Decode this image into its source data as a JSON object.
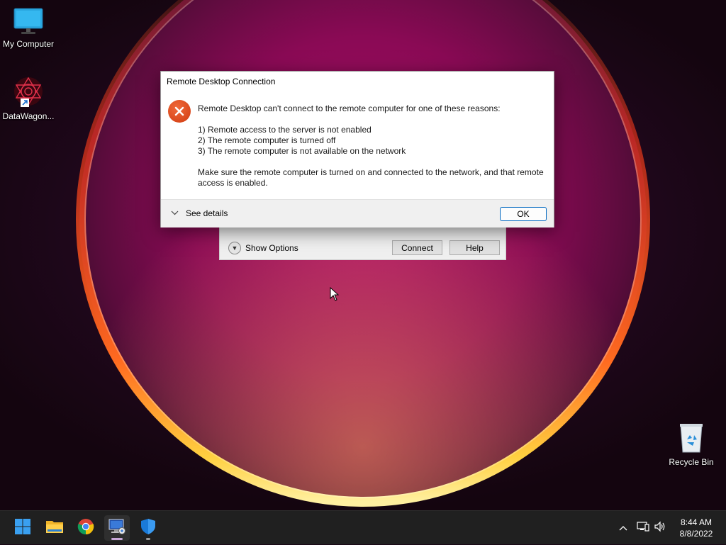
{
  "desktop": {
    "icons": [
      {
        "label": "My Computer",
        "icon": "monitor-icon"
      },
      {
        "label": "DataWagon...",
        "icon": "datawagon-shortcut-icon"
      },
      {
        "label": "Recycle Bin",
        "icon": "recycle-bin-icon"
      }
    ]
  },
  "rdc_window": {
    "show_options_label": "Show Options",
    "connect_label": "Connect",
    "help_label": "Help"
  },
  "dialog": {
    "title": "Remote Desktop Connection",
    "icon": "error-icon",
    "headline": "Remote Desktop can't connect to the remote computer for one of these reasons:",
    "reasons": [
      "1) Remote access to the server is not enabled",
      "2) The remote computer is turned off",
      "3) The remote computer is not available on the network"
    ],
    "advice": "Make sure the remote computer is turned on and connected to the network, and that remote access is enabled.",
    "see_details_label": "See details",
    "ok_label": "OK"
  },
  "taskbar": {
    "apps": [
      {
        "name": "start",
        "icon": "windows-start-icon"
      },
      {
        "name": "file-explorer",
        "icon": "folder-icon"
      },
      {
        "name": "chrome",
        "icon": "chrome-icon"
      },
      {
        "name": "remote-desktop",
        "icon": "remote-desktop-icon",
        "active": true
      },
      {
        "name": "windows-security",
        "icon": "shield-icon"
      }
    ],
    "tray": {
      "time": "8:44 AM",
      "date": "8/8/2022"
    }
  },
  "colors": {
    "accent": "#0067c0",
    "error": "#d8461c",
    "taskbar": "#202020"
  }
}
